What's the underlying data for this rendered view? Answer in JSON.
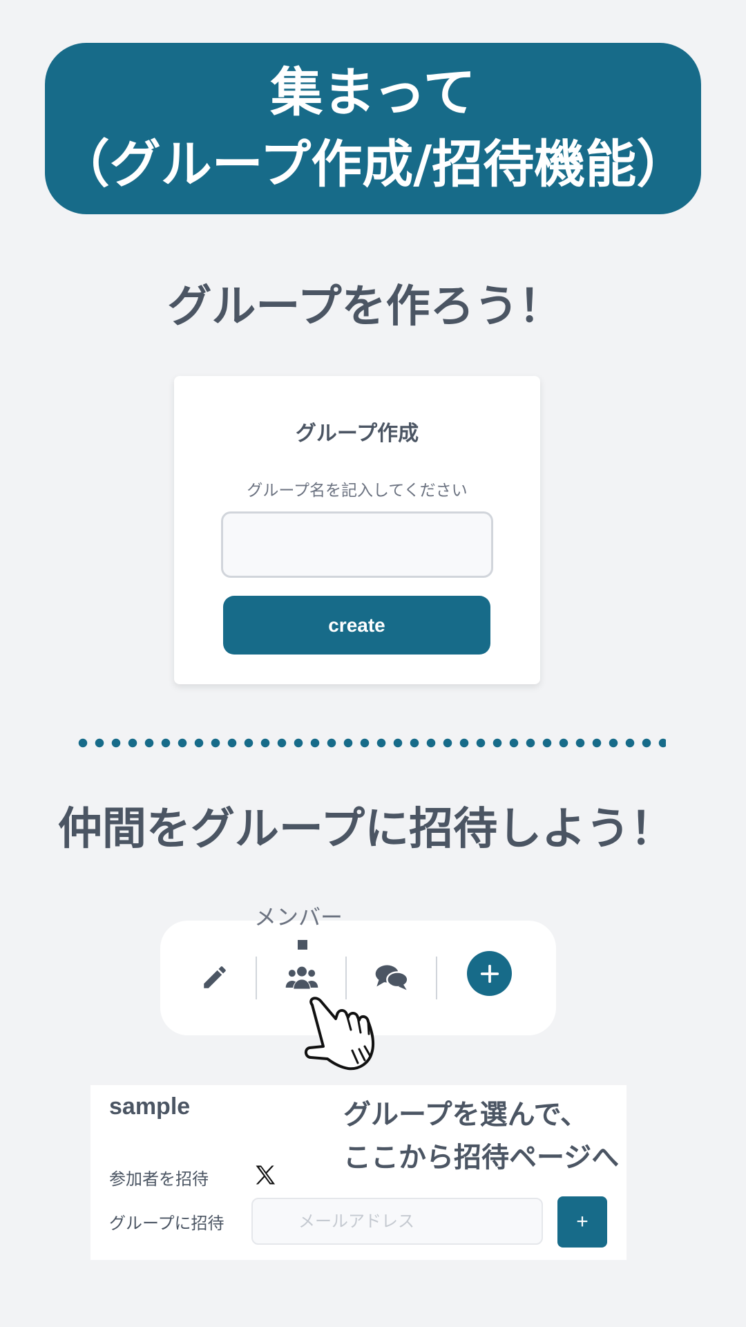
{
  "banner": {
    "line1": "集まって",
    "line2": "（グループ作成/招待機能）"
  },
  "create_section": {
    "heading": "グループを作ろう！",
    "card_title": "グループ作成",
    "input_hint": "グループ名を記入してください",
    "input_value": "",
    "button_label": "create"
  },
  "invite_section": {
    "heading": "仲間をグループに招待しよう！",
    "tooltip_label": "メンバー",
    "toolbar_icons": [
      "pencil-icon",
      "users-icon",
      "chat-icon",
      "plus-icon"
    ],
    "panel": {
      "group_name": "sample",
      "callout_line1": "グループを選んで、",
      "callout_line2": "ここから招待ページへ",
      "invite_participants_label": "参加者を招待",
      "invite_to_group_label": "グループに招待",
      "email_placeholder": "メールアドレス",
      "email_add_label": "+"
    }
  },
  "colors": {
    "accent": "#176b89",
    "background": "#f2f3f5",
    "text": "#4b5563"
  }
}
